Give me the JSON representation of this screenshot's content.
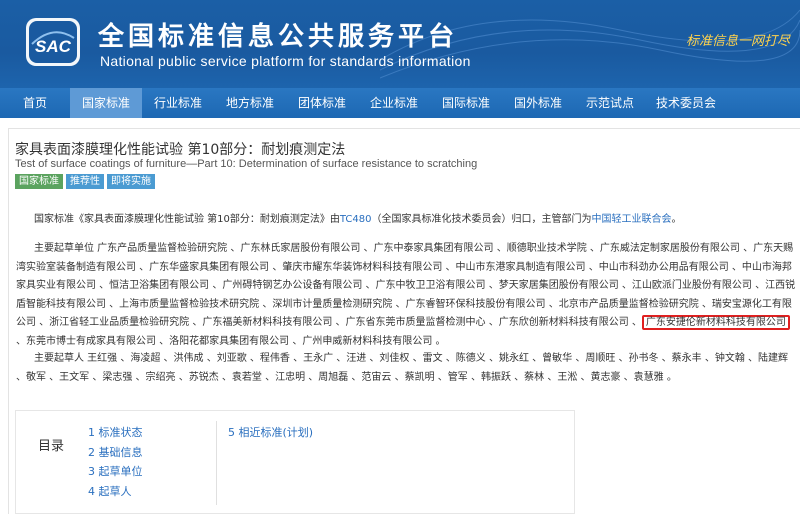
{
  "header": {
    "logo_text": "SAC",
    "title_cn": "全国标准信息公共服务平台",
    "title_en": "National public service platform  for standards information",
    "slogan": "标准信息一网打尽"
  },
  "nav": [
    {
      "label": "首页",
      "active": false
    },
    {
      "label": "国家标准",
      "active": true
    },
    {
      "label": "行业标准",
      "active": false
    },
    {
      "label": "地方标准",
      "active": false
    },
    {
      "label": "团体标准",
      "active": false
    },
    {
      "label": "企业标准",
      "active": false
    },
    {
      "label": "国际标准",
      "active": false
    },
    {
      "label": "国外标准",
      "active": false
    },
    {
      "label": "示范试点",
      "active": false
    },
    {
      "label": "技术委员会",
      "active": false
    }
  ],
  "standard": {
    "title": "家具表面漆膜理化性能试验 第10部分：耐划痕测定法",
    "title_en": "Test of surface coatings of furniture—Part 10: Determination of surface resistance to scratching",
    "badges": [
      "国家标准",
      "推荐性",
      "即将实施"
    ]
  },
  "intro": {
    "prefix": "国家标准《家具表面漆膜理化性能试验 第10部分：耐划痕测定法》由",
    "tc_link": "TC480",
    "mid": "（全国家具标准化技术委员会）归口，主管部门为",
    "dept_link": "中国轻工业联合会",
    "suffix": "。"
  },
  "drafting_units": {
    "before": "主要起草单位 广东产品质量监督检验研究院 、广东林氏家居股份有限公司 、广东中泰家具集团有限公司 、顺德职业技术学院 、广东威法定制家居股份有限公司 、广东天赐湾实验室装备制造有限公司 、广东华盛家具集团有限公司 、肇庆市耀东华装饰材料科技有限公司 、中山市东港家具制造有限公司 、中山市科劲办公用品有限公司 、中山市海邦家具实业有限公司 、恒洁卫浴集团有限公司 、广州碍特钢艺办公设备有限公司 、广东中牧卫卫浴有限公司 、梦天家居集团股份有限公司 、江山欧派门业股份有限公司 、江西锐盾智能科技有限公司 、上海市质量监督检验技术研究院 、深圳市计量质量检测研究院 、广东睿智环保科技股份有限公司 、北京市产品质量监督检验研究院 、瑞安宝源化工有限公司 、浙江省轻工业品质量检验研究院 、广东福美新材料科技有限公司 、广东省东莞市质量监督检测中心 、广东欣创新材料科技有限公司 、",
    "highlight": "广东安捷伦新材料科技有限公司",
    "after": " 、东莞市博士有成家具有限公司 、洛阳花都家具集团有限公司 、广州申威新材料科技有限公司 。"
  },
  "drafters": {
    "text": "主要起草人 王红强 、海凌超 、洪伟成 、刘亚歌 、程伟香 、王永广 、汪进 、刘佳权 、雷文 、陈德义 、姚永红 、曾敏华 、周顺旺 、孙书冬 、蔡永丰 、钟文翰 、陆建辉 、敬军 、王文军 、梁志强 、宗绍亮 、苏锐杰 、袁若堂 、江忠明 、周旭磊 、范宙云 、蔡凯明 、管军 、韩振跃 、蔡林 、王淞 、黄志豪 、袁慧雅 。"
  },
  "toc": {
    "label": "目录",
    "left": [
      "1  标准状态",
      "2  基础信息",
      "3  起草单位",
      "4  起草人"
    ],
    "right": [
      "5  相近标准(计划)"
    ]
  },
  "colors": {
    "header_blue": "#1b5fa6",
    "nav_active": "#5e9ad6",
    "link_blue": "#2a6fbf",
    "highlight_red": "#e02020",
    "badge_green": "#5ba35f",
    "badge_blue": "#4b9bd2"
  }
}
